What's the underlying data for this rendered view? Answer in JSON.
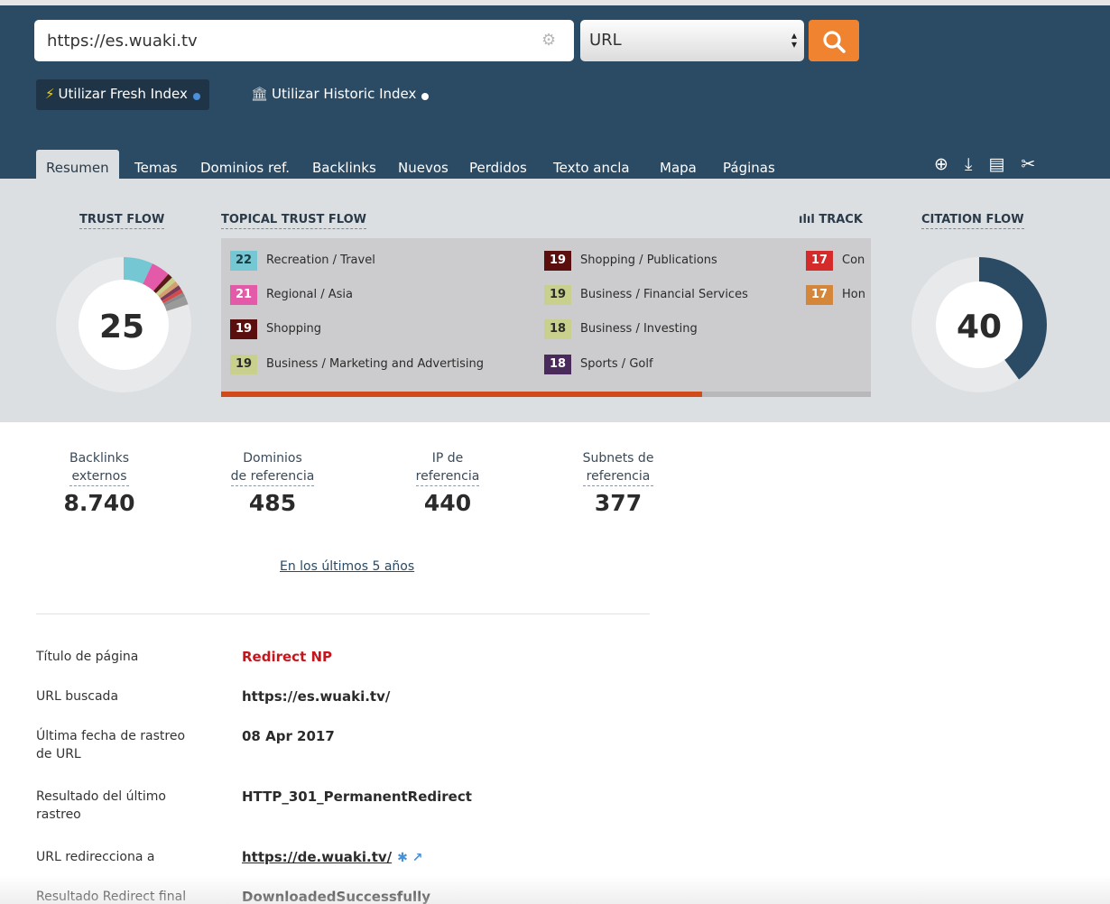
{
  "search": {
    "url_value": "https://es.wuaki.tv",
    "type_selected": "URL",
    "fresh_index_label": "Utilizar Fresh Index",
    "historic_index_label": "Utilizar Historic Index"
  },
  "tabs": [
    {
      "label": "Resumen",
      "active": true
    },
    {
      "label": "Temas"
    },
    {
      "label": "Dominios ref."
    },
    {
      "label": "Backlinks"
    },
    {
      "label": "Nuevos"
    },
    {
      "label": "Perdidos"
    },
    {
      "label": "Texto ancla"
    },
    {
      "label": "Mapa"
    },
    {
      "label": "Páginas"
    }
  ],
  "tool_icons": [
    "add-report-icon",
    "download-icon",
    "export-icon",
    "tools-icon"
  ],
  "trust_flow": {
    "title": "TRUST FLOW",
    "value": "25",
    "segments": [
      {
        "fraction": 0.07,
        "color": "#76c7d4"
      },
      {
        "fraction": 0.045,
        "color": "#e35aa8"
      },
      {
        "fraction": 0.012,
        "color": "#5a1a1a"
      },
      {
        "fraction": 0.012,
        "color": "#c9cf8c"
      },
      {
        "fraction": 0.012,
        "color": "#d4a070"
      },
      {
        "fraction": 0.01,
        "color": "#7a3a5a"
      },
      {
        "fraction": 0.01,
        "color": "#d44a4a"
      },
      {
        "fraction": 0.01,
        "color": "#8a8a8a"
      },
      {
        "fraction": 0.02,
        "color": "#9a9a9a"
      }
    ]
  },
  "topical_trust_flow": {
    "title": "TOPICAL TRUST FLOW",
    "items": [
      {
        "score": "22",
        "label": "Recreation / Travel",
        "color": "#76c7d4",
        "text_color": "#1a3a40"
      },
      {
        "score": "21",
        "label": "Regional / Asia",
        "color": "#e35aa8",
        "text_color": "#ffffff"
      },
      {
        "score": "19",
        "label": "Shopping",
        "color": "#5a0e0e",
        "text_color": "#ffffff"
      },
      {
        "score": "19",
        "label": "Business / Marketing and Advertising",
        "color": "#c9cf8c",
        "text_color": "#2b2b2b"
      },
      {
        "score": "19",
        "label": "Shopping / Publications",
        "color": "#5a0e0e",
        "text_color": "#ffffff"
      },
      {
        "score": "19",
        "label": "Business / Financial Services",
        "color": "#c9cf8c",
        "text_color": "#2b2b2b"
      },
      {
        "score": "18",
        "label": "Business / Investing",
        "color": "#c9cf8c",
        "text_color": "#2b2b2b"
      },
      {
        "score": "18",
        "label": "Sports / Golf",
        "color": "#4a2a5a",
        "text_color": "#ffffff"
      },
      {
        "score": "17",
        "label": "Con",
        "color": "#d42a2a",
        "text_color": "#ffffff"
      },
      {
        "score": "17",
        "label": "Hon",
        "color": "#d4863a",
        "text_color": "#ffffff"
      }
    ],
    "scroll_fraction": 0.74,
    "scroll_color": "#d04a1a"
  },
  "track": {
    "title": "TRACK"
  },
  "citation_flow": {
    "title": "CITATION FLOW",
    "value": "40",
    "fraction": 0.4,
    "color": "#2b4a63"
  },
  "stats": [
    {
      "label_line1": "Backlinks",
      "label_line2": "externos",
      "value": "8.740"
    },
    {
      "label_line1": "Dominios",
      "label_line2": "de referencia",
      "value": "485"
    },
    {
      "label_line1": "IP de",
      "label_line2": "referencia",
      "value": "440"
    },
    {
      "label_line1": "Subnets de",
      "label_line2": "referencia",
      "value": "377"
    }
  ],
  "period_link": "En los últimos 5 años",
  "details": {
    "page_title_label": "Título de página",
    "page_title_value": "Redirect NP",
    "url_label": "URL buscada",
    "url_value": "https://es.wuaki.tv/",
    "crawl_date_label_1": "Última fecha de rastreo",
    "crawl_date_label_2": "de URL",
    "crawl_date_value": "08 Apr 2017",
    "crawl_result_label_1": "Resultado del último",
    "crawl_result_label_2": "rastreo",
    "crawl_result_value": "HTTP_301_PermanentRedirect",
    "redirect_label": "URL redirecciona a",
    "redirect_value": "https://de.wuaki.tv/",
    "final_label": "Resultado Redirect final",
    "final_value": "DownloadedSuccessfully"
  }
}
